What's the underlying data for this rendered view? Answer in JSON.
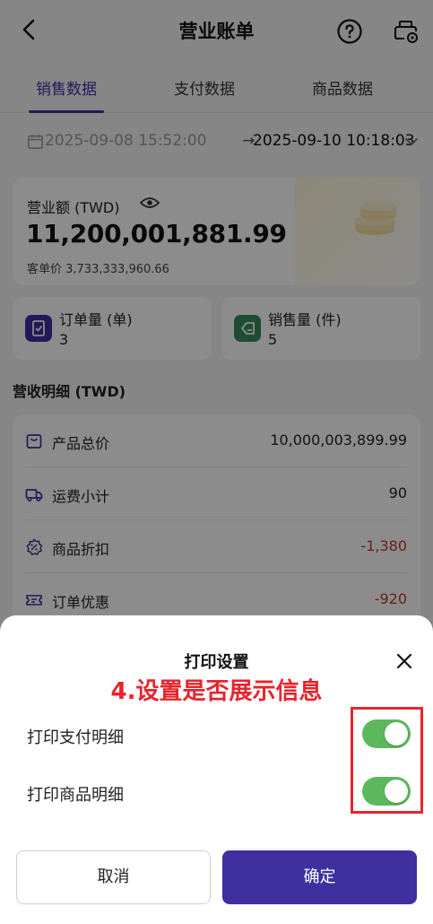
{
  "header": {
    "title": "营业账单",
    "back_icon": "chevron-left-icon",
    "help_icon": "help-circle-icon",
    "print_icon": "printer-settings-icon"
  },
  "tabs": [
    {
      "label": "销售数据",
      "active": true
    },
    {
      "label": "支付数据",
      "active": false
    },
    {
      "label": "商品数据",
      "active": false
    }
  ],
  "date_range": {
    "start": "2025-09-08 15:52:00",
    "arrow": "→",
    "end": "2025-09-10 10:18:03"
  },
  "revenue": {
    "label": "营业额 (TWD)",
    "value": "11,200,001,881.99",
    "avg_label": "客单价",
    "avg_value": "3,733,333,960.66"
  },
  "stats": [
    {
      "label": "订单量 (单)",
      "value": "3",
      "icon": "order-icon",
      "color": "#3f2f9f"
    },
    {
      "label": "销售量 (件)",
      "value": "5",
      "icon": "tag-icon",
      "color": "#3a8a5a"
    }
  ],
  "detail": {
    "title": "营收明细 (TWD)",
    "rows": [
      {
        "label": "产品总价",
        "value": "10,000,003,899.99",
        "icon": "box-icon",
        "negative": false
      },
      {
        "label": "运费小计",
        "value": "90",
        "icon": "truck-icon",
        "negative": false
      },
      {
        "label": "商品折扣",
        "value": "-1,380",
        "icon": "discount-icon",
        "negative": true
      },
      {
        "label": "订单优惠",
        "value": "-920",
        "icon": "coupon-icon",
        "negative": true
      }
    ]
  },
  "print_sheet": {
    "title": "打印设置",
    "annotation": "4.设置是否展示信息",
    "options": [
      {
        "label": "打印支付明细",
        "enabled": true
      },
      {
        "label": "打印商品明细",
        "enabled": true
      }
    ],
    "cancel_label": "取消",
    "confirm_label": "确定"
  },
  "colors": {
    "accent": "#3f2f9f",
    "toggle_on": "#5cb85c",
    "negative": "#c0392b",
    "annotation": "#e8242c"
  }
}
